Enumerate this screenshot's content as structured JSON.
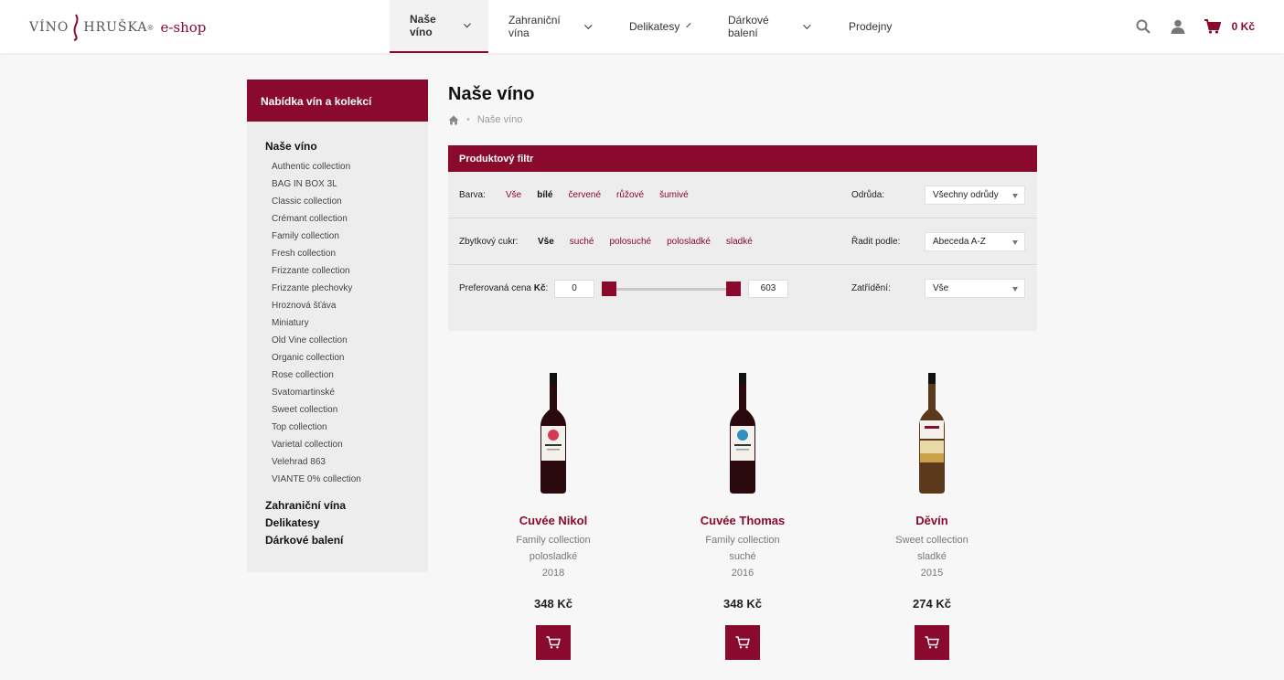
{
  "brand": {
    "part1": "VÍNO",
    "part2": "HRUŠKA",
    "reg": "®",
    "shop": "e-shop",
    "accent": "#8a0a2d"
  },
  "nav": {
    "items": [
      {
        "label": "Naše víno",
        "dropdown": true,
        "active": true
      },
      {
        "label": "Zahraniční vína",
        "dropdown": true
      },
      {
        "label": "Delikatesy",
        "dropdown": true
      },
      {
        "label": "Dárkové balení",
        "dropdown": true
      },
      {
        "label": "Prodejny",
        "dropdown": false
      }
    ]
  },
  "tools": {
    "search_icon": "search-icon",
    "user_icon": "user-icon",
    "cart_icon": "cart-icon",
    "cart_total": "0 Kč"
  },
  "sidebar": {
    "heading": "Nabídka vín a kolekcí",
    "section_title": "Naše víno",
    "items": [
      "Authentic collection",
      "BAG IN BOX 3L",
      "Classic collection",
      "Crémant collection",
      "Family collection",
      "Fresh collection",
      "Frizzante collection",
      "Frizzante plechovky",
      "Hroznová šťáva",
      "Miniatury",
      "Old Vine collection",
      "Organic collection",
      "Rose collection",
      "Svatomartinské",
      "Sweet collection",
      "Top collection",
      "Varietal collection",
      "Velehrad 863",
      "VIANTE 0% collection"
    ],
    "bottom": [
      "Zahraniční vína",
      "Delikatesy",
      "Dárkové balení"
    ]
  },
  "main": {
    "title": "Naše víno",
    "breadcrumb": {
      "home_icon": "home-icon",
      "sep": "•",
      "current": "Naše víno"
    }
  },
  "filter": {
    "heading": "Produktový filtr",
    "color": {
      "label": "Barva:",
      "options": [
        "Vše",
        "bílé",
        "červené",
        "růžové",
        "šumivé"
      ],
      "selected": "bílé"
    },
    "sugar": {
      "label": "Zbytkový cukr:",
      "options": [
        "Vše",
        "suché",
        "polosuché",
        "polosladké",
        "sladké"
      ],
      "selected": "Vše"
    },
    "price": {
      "label_prefix": "Preferovaná cena ",
      "label_unit": "Kč",
      "label_suffix": ":",
      "min": "0",
      "max": "603"
    },
    "variety": {
      "label": "Odrůda:",
      "value": "Všechny odrůdy"
    },
    "sort": {
      "label": "Řadit podle:",
      "value": "Abeceda A-Z"
    },
    "category": {
      "label": "Zatřídění:",
      "value": "Vše"
    }
  },
  "products": [
    {
      "name": "Cuvée Nikol",
      "collection": "Family collection",
      "sweetness": "polosladké",
      "year": "2018",
      "price": "348 Kč",
      "label_color": "#d63a52",
      "wine_color": "#2a0a0e"
    },
    {
      "name": "Cuvée Thomas",
      "collection": "Family collection",
      "sweetness": "suché",
      "year": "2016",
      "price": "348 Kč",
      "label_color": "#2f8fbf",
      "wine_color": "#2a0a0e"
    },
    {
      "name": "Děvín",
      "collection": "Sweet collection",
      "sweetness": "sladké",
      "year": "2015",
      "price": "274 Kč",
      "label_color": "#c9a24a",
      "wine_color": "#5a3a1a"
    }
  ]
}
